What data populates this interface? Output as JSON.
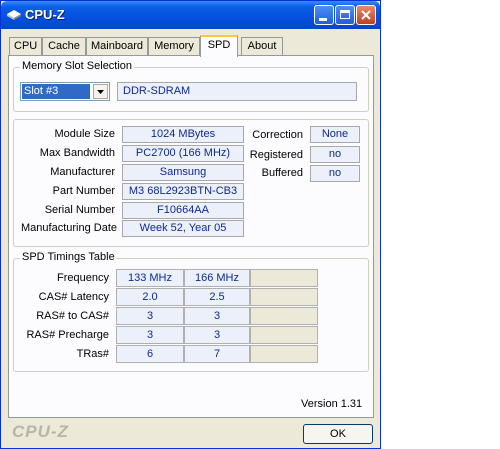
{
  "window": {
    "title": "CPU-Z"
  },
  "tabs": [
    {
      "label": "CPU"
    },
    {
      "label": "Cache"
    },
    {
      "label": "Mainboard"
    },
    {
      "label": "Memory"
    },
    {
      "label": "SPD"
    },
    {
      "label": "About"
    }
  ],
  "slot_section": {
    "title": "Memory Slot Selection",
    "selected_slot": "Slot #3",
    "memory_type": "DDR-SDRAM"
  },
  "module": {
    "rows": [
      {
        "label": "Module Size",
        "value": "1024 MBytes"
      },
      {
        "label": "Max Bandwidth",
        "value": "PC2700 (166 MHz)"
      },
      {
        "label": "Manufacturer",
        "value": "Samsung"
      },
      {
        "label": "Part Number",
        "value": "M3 68L2923BTN-CB3"
      },
      {
        "label": "Serial Number",
        "value": "F10664AA"
      },
      {
        "label": "Manufacturing Date",
        "value": "Week 52, Year 05"
      }
    ],
    "flags": [
      {
        "label": "Correction",
        "value": "None"
      },
      {
        "label": "Registered",
        "value": "no"
      },
      {
        "label": "Buffered",
        "value": "no"
      }
    ]
  },
  "timings": {
    "title": "SPD Timings Table",
    "rows": [
      {
        "label": "Frequency",
        "v1": "133 MHz",
        "v2": "166 MHz"
      },
      {
        "label": "CAS# Latency",
        "v1": "2.0",
        "v2": "2.5"
      },
      {
        "label": "RAS# to CAS#",
        "v1": "3",
        "v2": "3"
      },
      {
        "label": "RAS# Precharge",
        "v1": "3",
        "v2": "3"
      },
      {
        "label": "TRas#",
        "v1": "6",
        "v2": "7"
      }
    ]
  },
  "footer": {
    "version": "Version 1.31",
    "brand": "CPU-Z",
    "ok_label": "OK"
  }
}
